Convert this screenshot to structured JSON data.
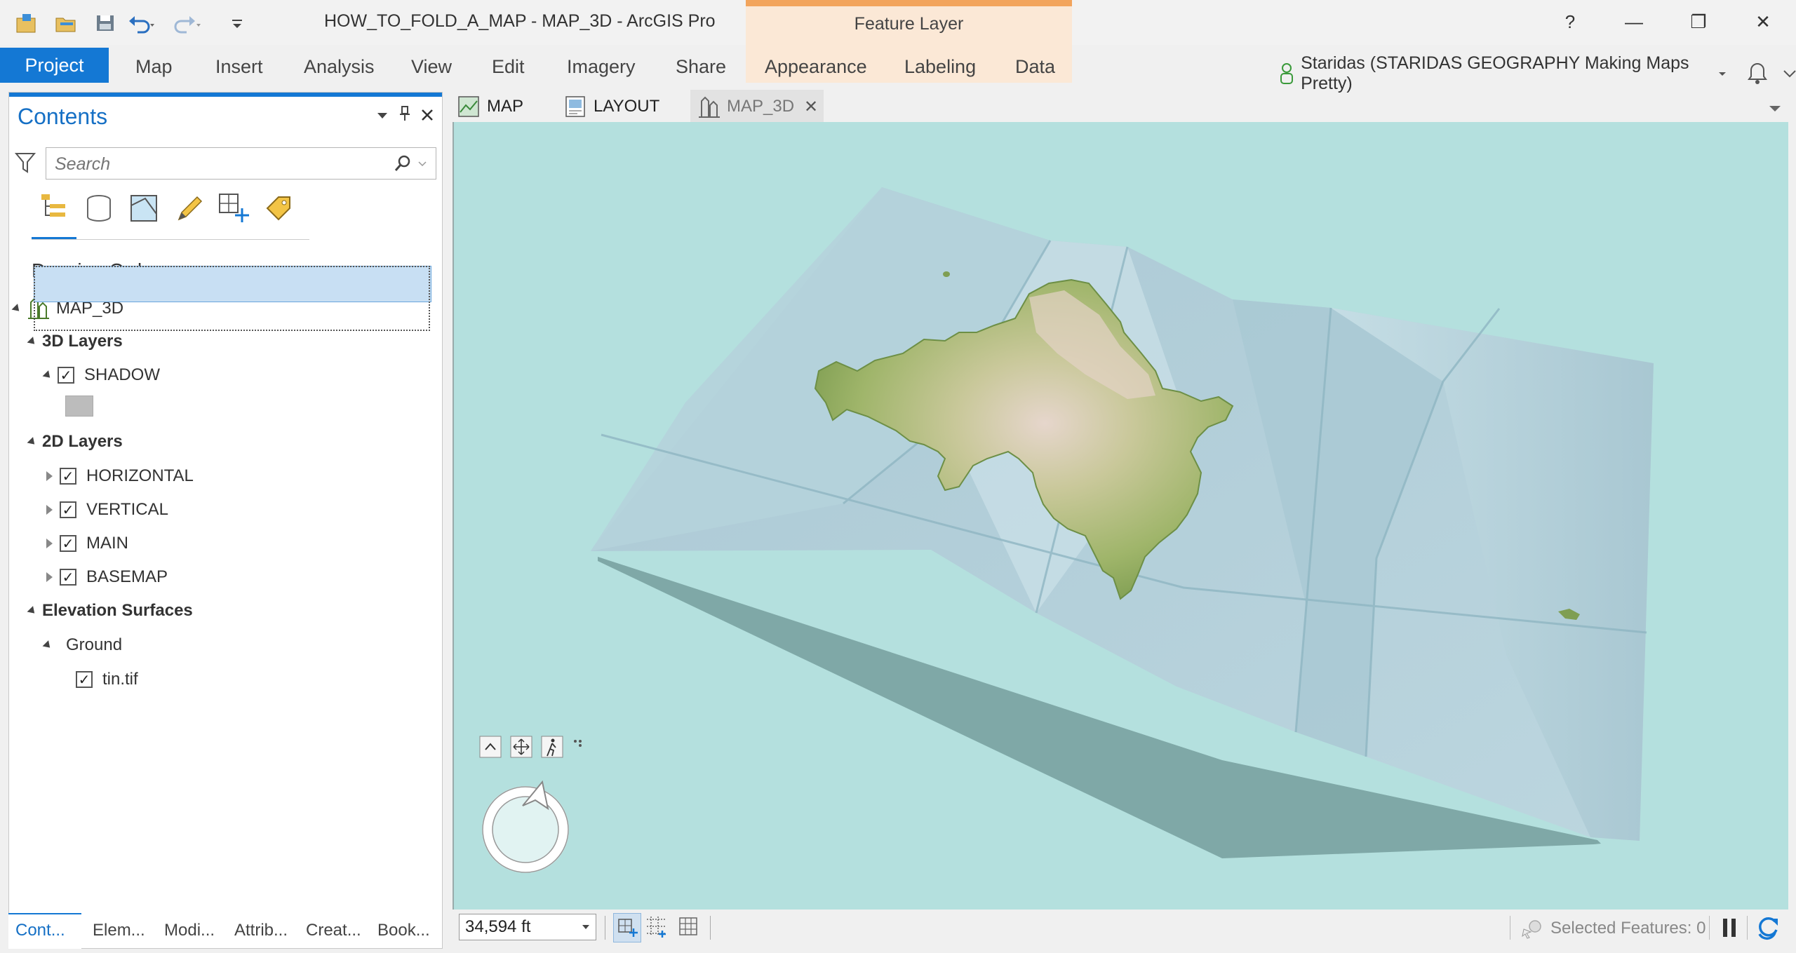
{
  "window": {
    "title": "HOW_TO_FOLD_A_MAP - MAP_3D - ArcGIS Pro",
    "help": "?",
    "minimize": "—",
    "maximize": "❐",
    "close": "✕"
  },
  "contextual": {
    "group": "Feature Layer"
  },
  "ribbon": {
    "project": "Project",
    "tabs": [
      "Map",
      "Insert",
      "Analysis",
      "View",
      "Edit",
      "Imagery",
      "Share",
      "Appearance",
      "Labeling",
      "Data"
    ]
  },
  "user": {
    "name": "Staridas (STARIDAS GEOGRAPHY Making Maps Pretty)"
  },
  "contents": {
    "title": "Contents",
    "search_placeholder": "Search",
    "drawing_order": "Drawing Order",
    "map": "MAP_3D",
    "groups": {
      "layers3d": "3D Layers",
      "shadow": "SHADOW",
      "layers2d": "2D Layers",
      "horizontal": "HORIZONTAL",
      "vertical": "VERTICAL",
      "main": "MAIN",
      "basemap": "BASEMAP",
      "elevation": "Elevation Surfaces",
      "ground": "Ground",
      "tin": "tin.tif"
    },
    "check": "✓"
  },
  "bottom_tabs": [
    "Cont...",
    "Elem...",
    "Modi...",
    "Attrib...",
    "Creat...",
    "Book..."
  ],
  "doc_tabs": {
    "map": "MAP",
    "layout": "LAYOUT",
    "map3d": "MAP_3D",
    "close": "✕"
  },
  "status": {
    "scale": "34,594 ft",
    "selected": "Selected Features: 0"
  },
  "colors": {
    "accent": "#1478d4",
    "contextual": "#f2a45c",
    "map_bg": "#b4e0de"
  }
}
